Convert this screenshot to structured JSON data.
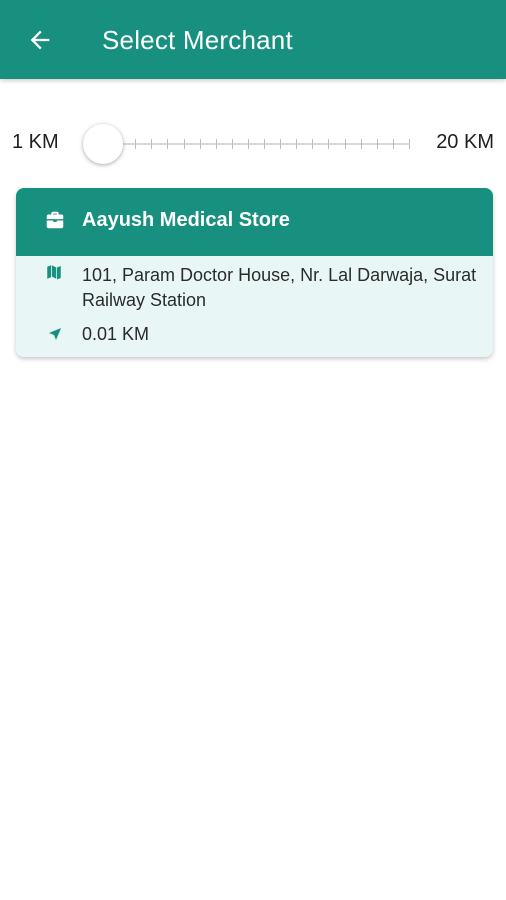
{
  "header": {
    "title": "Select Merchant",
    "back_icon": "arrow-left-icon",
    "background": "#17907f"
  },
  "distance_filter": {
    "min_label": "1 KM",
    "max_label": "20 KM",
    "min": 1,
    "max": 20,
    "value": 1
  },
  "merchants": [
    {
      "name": "Aayush Medical Store",
      "name_icon": "briefcase-icon",
      "address": "101, Param Doctor House, Nr. Lal Darwaja, Surat Railway Station",
      "address_icon": "map-icon",
      "distance": "0.01 KM",
      "distance_icon": "navigation-arrow-icon"
    }
  ],
  "colors": {
    "accent": "#17907f",
    "card_background": "#e8f7f5"
  }
}
